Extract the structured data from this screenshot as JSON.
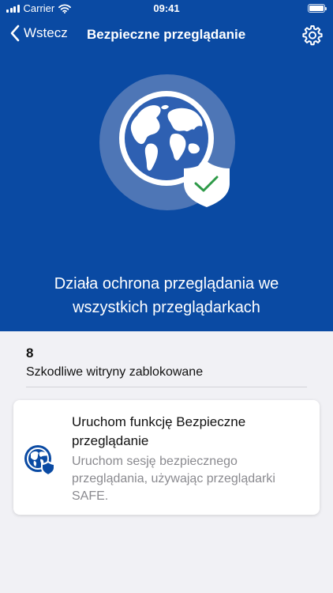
{
  "status_bar": {
    "carrier": "Carrier",
    "time": "09:41"
  },
  "nav": {
    "back_label": "Wstecz",
    "title": "Bezpieczne przeglądanie",
    "settings_icon": "gear-icon"
  },
  "hero": {
    "background": "#0a4aa3",
    "message": "Działa ochrona przeglądania we wszystkich przeglądarkach",
    "icon": "globe-shield-check-icon"
  },
  "stats": {
    "blocked_count": "8",
    "blocked_label": "Szkodliwe witryny zablokowane"
  },
  "card": {
    "title": "Uruchom funkcję Bezpieczne przeglądanie",
    "description": "Uruchom sesję bezpiecznego przeglądania, używając przeglądarki SAFE.",
    "icon": "globe-shield-icon",
    "accent": "#0a4aa3"
  }
}
